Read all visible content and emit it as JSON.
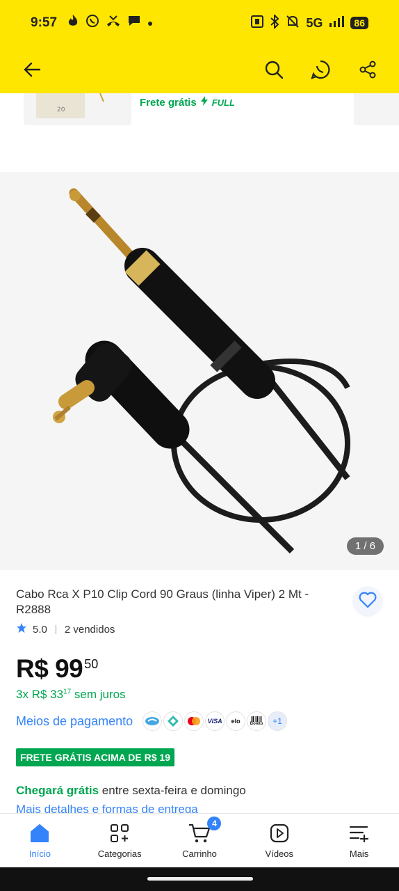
{
  "status_bar": {
    "time": "9:57",
    "network": "5G",
    "battery": "86",
    "icons": [
      "tinder-icon",
      "whatsapp-icon",
      "missed-call-icon",
      "chat-icon",
      "dot-icon"
    ]
  },
  "app_bar": {
    "icons": [
      "back-arrow-icon",
      "search-icon",
      "whatsapp-share-icon",
      "share-icon"
    ],
    "color": "#ffe600"
  },
  "recommendation_strip": {
    "shipping": "Frete grátis",
    "full_label": "FULL"
  },
  "gallery": {
    "counter": "1 / 6",
    "image": "cable-rca-p10-photo"
  },
  "product": {
    "title": "Cabo Rca X P10 Clip Cord 90 Graus (linha Viper) 2 Mt - R2888",
    "rating": "5.0",
    "sold": "2 vendidos",
    "price_main": "R$ 99",
    "price_cents": "50",
    "installments_prefix": "3x R$ 33",
    "installments_cents": "17",
    "installments_suffix": "sem juros"
  },
  "payment": {
    "label": "Meios de pagamento",
    "methods": [
      "mercado-pago",
      "pix",
      "mastercard",
      "VISA",
      "elo",
      "Boleto"
    ],
    "more": "+1"
  },
  "shipping": {
    "badge": "FRETE GRÁTIS ACIMA DE R$ 19",
    "arrival_green": "Chegará grátis",
    "arrival_rest": "entre sexta-feira e domingo",
    "more_details": "Mais detalhes e formas de entrega"
  },
  "tab_bar": {
    "tabs": [
      {
        "label": "Início",
        "icon": "home-icon"
      },
      {
        "label": "Categorias",
        "icon": "categories-icon"
      },
      {
        "label": "Carrinho",
        "icon": "cart-icon",
        "badge": "4"
      },
      {
        "label": "Vídeos",
        "icon": "video-icon"
      },
      {
        "label": "Mais",
        "icon": "menu-plus-icon"
      }
    ]
  },
  "colors": {
    "brand_yellow": "#ffe600",
    "accent_blue": "#3483fa",
    "green": "#00a650"
  }
}
